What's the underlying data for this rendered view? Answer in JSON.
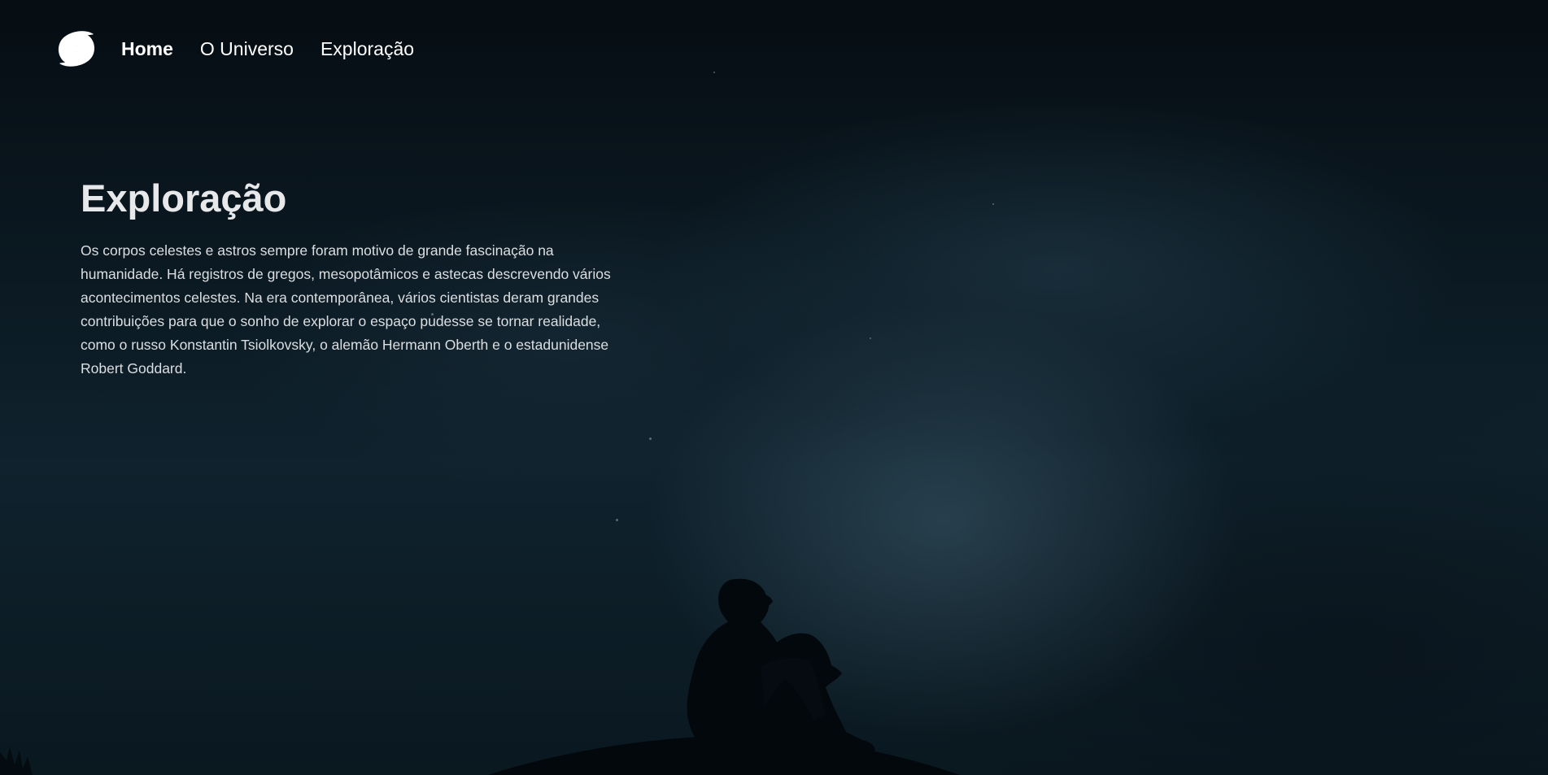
{
  "nav": {
    "logo_icon": "galaxy-swirl-icon",
    "items": [
      {
        "label": "Home",
        "active": true
      },
      {
        "label": "O Universo",
        "active": false
      },
      {
        "label": "Exploração",
        "active": false
      }
    ]
  },
  "hero": {
    "title": "Exploração",
    "body": "Os corpos celestes e astros sempre foram motivo de grande fascinação na humanidade. Há registros de gregos, mesopotâmicos e astecas descrevendo vários acontecimentos celestes. Na era contemporânea, vários cientistas deram grandes contribuições para que o sonho de explorar o espaço pudesse se tornar realidade, como o russo Konstantin Tsiolkovsky, o alemão Hermann Oberth e o estadunidense Robert Goddard."
  },
  "background": {
    "image": "person-silhouette-night-sky",
    "colors": {
      "sky_dark": "#071019",
      "sky_mid": "#0f222d",
      "silhouette": "#03080c"
    }
  }
}
